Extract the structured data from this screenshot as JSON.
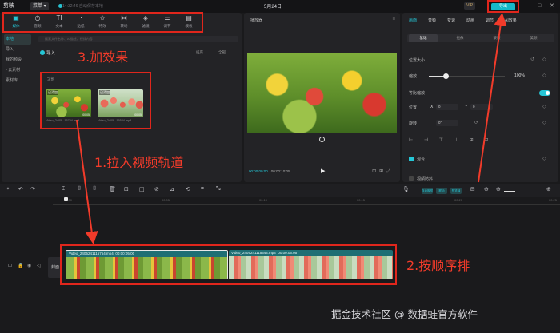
{
  "titlebar": {
    "app_name": "剪映",
    "menu_label": "菜单",
    "autosave": "14:32:46 自动保存本地",
    "doc_title": "5月24日",
    "vip_label": "VIP",
    "export_label": "导出"
  },
  "toolbar": {
    "tools": [
      {
        "label": "媒体",
        "icon": "media-icon"
      },
      {
        "label": "音频",
        "icon": "audio-icon"
      },
      {
        "label": "文本",
        "icon": "text-icon"
      },
      {
        "label": "贴纸",
        "icon": "sticker-icon"
      },
      {
        "label": "特效",
        "icon": "effects-icon"
      },
      {
        "label": "转场",
        "icon": "transition-icon"
      },
      {
        "label": "滤镜",
        "icon": "filter-icon"
      },
      {
        "label": "调节",
        "icon": "adjust-icon"
      },
      {
        "label": "模板",
        "icon": "template-icon"
      }
    ]
  },
  "media": {
    "nav": [
      "本地",
      "导入",
      "我的预设",
      "云素材",
      "素材库"
    ],
    "search_placeholder": "搜索文件名称、AI描述、视频内容",
    "import_label": "导入",
    "sort_label": "排序",
    "all_label": "全部",
    "section_label": "全部",
    "items": [
      {
        "tag": "已添加",
        "name": "Video_2405...15754.mp4",
        "duration": "00:05"
      },
      {
        "tag": "已添加",
        "name": "Video_2405...15544.mp4",
        "duration": "00:05"
      }
    ]
  },
  "annotations": {
    "add_effects": "3.加效果",
    "drag_track": "1.拉入视频轨道",
    "order": "2.按顺序排"
  },
  "player": {
    "title": "播放器",
    "current_time": "00:00:00:00",
    "total_time": "00:00:10:05"
  },
  "properties": {
    "tabs": [
      "画面",
      "音频",
      "变速",
      "动画",
      "调节",
      "AI效果"
    ],
    "sub_tabs": [
      "基础",
      "抠像",
      "蒙版",
      "美颜"
    ],
    "section_title": "位置大小",
    "scale_label": "缩放",
    "scale_value": "100%",
    "uniform_label": "等比缩放",
    "position_label": "位置",
    "pos_x": "0",
    "pos_y": "0",
    "rotate_label": "旋转",
    "rotate_value": "0°",
    "blend_label": "混合",
    "video_stab_label": "视频防抖"
  },
  "timeline": {
    "ruler": [
      "00:00",
      "00:05",
      "00:10",
      "00:15",
      "00:20",
      "00:25"
    ],
    "cover_label": "封面",
    "chips": [
      "自动吸附",
      "联动",
      "预览轴"
    ],
    "clips": [
      {
        "name": "Video_2405241115754.mp4",
        "duration": "00:00:05:00"
      },
      {
        "name": "Video_2405241115544.mp4",
        "duration": "00:00:05:05"
      }
    ]
  },
  "watermark": "掘金技术社区 @ 数据蛙官方软件",
  "colors": {
    "accent": "#25c6d6",
    "annotation_red": "#f23b2a",
    "background": "#1a1a1c"
  }
}
